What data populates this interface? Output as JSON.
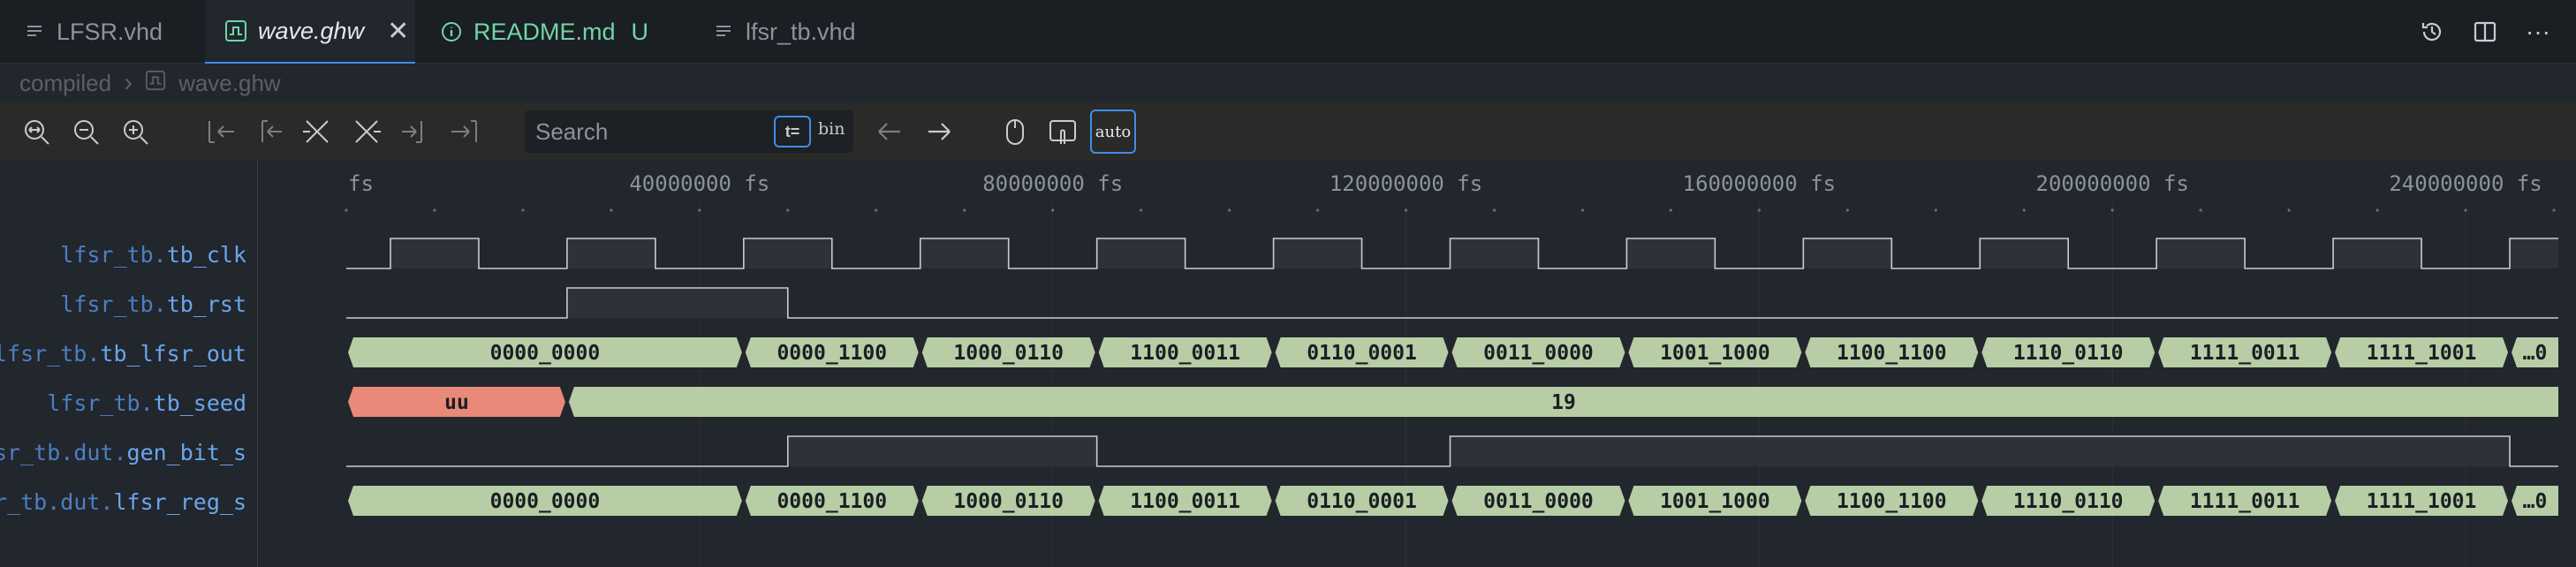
{
  "tabs": [
    {
      "label": "LFSR.vhd",
      "icon": "lines-icon"
    },
    {
      "label": "wave.ghw",
      "icon": "waveform-file-icon"
    },
    {
      "label": "README.md",
      "icon": "info-icon",
      "badge": "U"
    },
    {
      "label": "lfsr_tb.vhd",
      "icon": "lines-icon"
    }
  ],
  "breadcrumb": {
    "root": "compiled",
    "file": "wave.ghw"
  },
  "search": {
    "placeholder": "Search"
  },
  "toolbar": {
    "t_equal": "t=",
    "radix": "bin",
    "auto_label": "auto"
  },
  "colors": {
    "accent": "#3f8ee6",
    "bus_fill": "#b7cda5",
    "undefined_fill": "#e8897a",
    "signal_name": "#6aa6ee",
    "modified": "#6fd6a6"
  },
  "timeline": {
    "start_label": "fs",
    "ticks": [
      {
        "t": 40000000,
        "label": "40000000 fs"
      },
      {
        "t": 80000000,
        "label": "80000000 fs"
      },
      {
        "t": 120000000,
        "label": "120000000 fs"
      },
      {
        "t": 160000000,
        "label": "160000000 fs"
      },
      {
        "t": 200000000,
        "label": "200000000 fs"
      },
      {
        "t": 240000000,
        "label": "240000000 fs"
      }
    ],
    "t_end": 250500000
  },
  "signals": [
    {
      "scope": "lfsr_tb.",
      "leaf": "tb_clk",
      "kind": "bit",
      "edges": [
        [
          0,
          0
        ],
        [
          5000000,
          1
        ],
        [
          15000000,
          0
        ],
        [
          25000000,
          1
        ],
        [
          35000000,
          0
        ],
        [
          45000000,
          1
        ],
        [
          55000000,
          0
        ],
        [
          65000000,
          1
        ],
        [
          75000000,
          0
        ],
        [
          85000000,
          1
        ],
        [
          95000000,
          0
        ],
        [
          105000000,
          1
        ],
        [
          115000000,
          0
        ],
        [
          125000000,
          1
        ],
        [
          135000000,
          0
        ],
        [
          145000000,
          1
        ],
        [
          155000000,
          0
        ],
        [
          165000000,
          1
        ],
        [
          175000000,
          0
        ],
        [
          185000000,
          1
        ],
        [
          195000000,
          0
        ],
        [
          205000000,
          1
        ],
        [
          215000000,
          0
        ],
        [
          225000000,
          1
        ],
        [
          235000000,
          0
        ],
        [
          245000000,
          1
        ]
      ]
    },
    {
      "scope": "lfsr_tb.",
      "leaf": "tb_rst",
      "kind": "bit",
      "edges": [
        [
          0,
          0
        ],
        [
          25000000,
          1
        ],
        [
          50000000,
          0
        ]
      ]
    },
    {
      "scope": "lfsr_tb.",
      "leaf": "tb_lfsr_out",
      "kind": "bus",
      "segments": [
        {
          "t": 0,
          "value": "0000_0000"
        },
        {
          "t": 45000000,
          "value": "0000_1100"
        },
        {
          "t": 65000000,
          "value": "1000_0110"
        },
        {
          "t": 85000000,
          "value": "1100_0011"
        },
        {
          "t": 105000000,
          "value": "0110_0001"
        },
        {
          "t": 125000000,
          "value": "0011_0000"
        },
        {
          "t": 145000000,
          "value": "1001_1000"
        },
        {
          "t": 165000000,
          "value": "1100_1100"
        },
        {
          "t": 185000000,
          "value": "1110_0110"
        },
        {
          "t": 205000000,
          "value": "1111_0011"
        },
        {
          "t": 225000000,
          "value": "1111_1001"
        },
        {
          "t": 245000000,
          "value": "…0"
        }
      ]
    },
    {
      "scope": "lfsr_tb.",
      "leaf": "tb_seed",
      "kind": "bus",
      "segments": [
        {
          "t": 0,
          "value": "uu",
          "undefined": true
        },
        {
          "t": 25000000,
          "value": "19"
        }
      ]
    },
    {
      "scope": "lfsr_tb.dut.",
      "leaf": "gen_bit_s",
      "kind": "bit",
      "edges": [
        [
          0,
          0
        ],
        [
          50000000,
          1
        ],
        [
          85000000,
          0
        ],
        [
          125000000,
          1
        ],
        [
          245000000,
          0
        ]
      ]
    },
    {
      "scope": "lfsr_tb.dut.",
      "leaf": "lfsr_reg_s",
      "kind": "bus",
      "segments": [
        {
          "t": 0,
          "value": "0000_0000"
        },
        {
          "t": 45000000,
          "value": "0000_1100"
        },
        {
          "t": 65000000,
          "value": "1000_0110"
        },
        {
          "t": 85000000,
          "value": "1100_0011"
        },
        {
          "t": 105000000,
          "value": "0110_0001"
        },
        {
          "t": 125000000,
          "value": "0011_0000"
        },
        {
          "t": 145000000,
          "value": "1001_1000"
        },
        {
          "t": 165000000,
          "value": "1100_1100"
        },
        {
          "t": 185000000,
          "value": "1110_0110"
        },
        {
          "t": 205000000,
          "value": "1111_0011"
        },
        {
          "t": 225000000,
          "value": "1111_1001"
        },
        {
          "t": 245000000,
          "value": "…0"
        }
      ]
    }
  ]
}
